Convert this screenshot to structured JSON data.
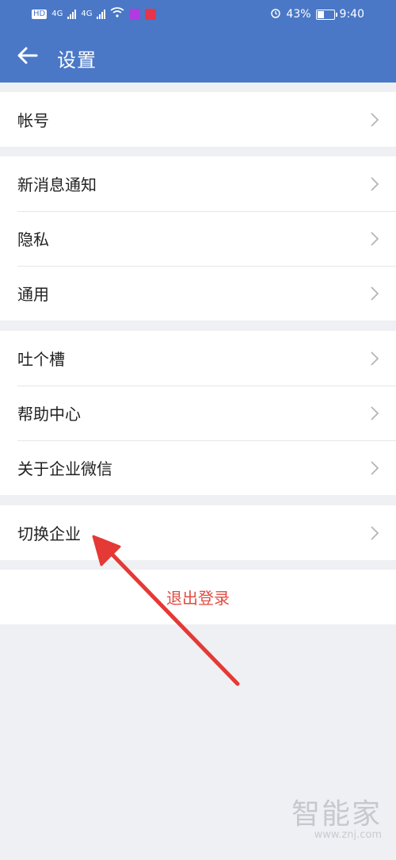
{
  "status": {
    "left_chips": [
      "HD",
      "4G",
      "4G"
    ],
    "battery_percent_text": "43%",
    "battery_level": 0.43,
    "time": "9:40"
  },
  "header": {
    "title": "设置",
    "back_icon": "arrow-left-icon"
  },
  "groups": [
    {
      "items": [
        {
          "label": "帐号"
        }
      ]
    },
    {
      "items": [
        {
          "label": "新消息通知"
        },
        {
          "label": "隐私"
        },
        {
          "label": "通用"
        }
      ]
    },
    {
      "items": [
        {
          "label": "吐个槽"
        },
        {
          "label": "帮助中心"
        },
        {
          "label": "关于企业微信"
        }
      ]
    },
    {
      "items": [
        {
          "label": "切换企业"
        }
      ]
    }
  ],
  "logout_label": "退出登录",
  "watermark": {
    "text": "智能家",
    "url": "www.znj.com"
  },
  "colors": {
    "header_bg": "#4a78c7",
    "logout_text": "#e24b41",
    "annotation_arrow": "#e53935"
  }
}
